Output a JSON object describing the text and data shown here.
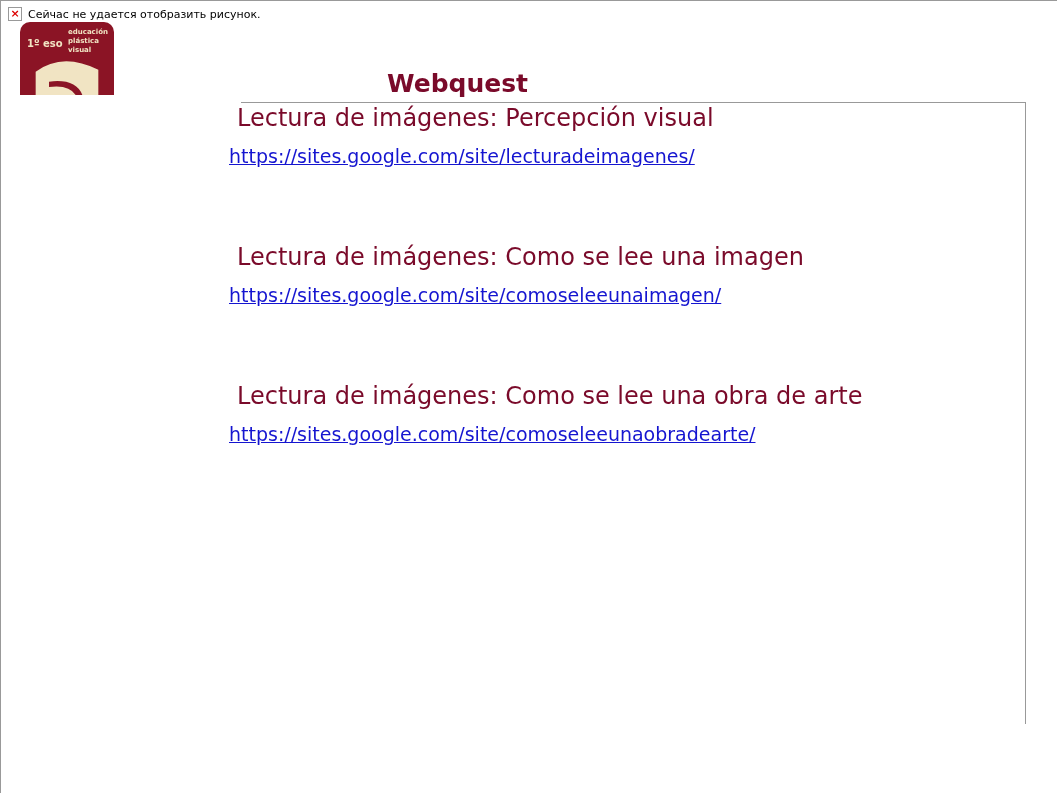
{
  "broken_image": {
    "icon": "×",
    "text": "Сейчас не удается отобразить рисунок."
  },
  "logo": {
    "course": "1º eso",
    "subject": [
      "educación",
      "plástica",
      "visual"
    ]
  },
  "title": "Webquest",
  "sections": [
    {
      "heading": "Lectura de imágenes: Percepción visual",
      "link": "https://sites.google.com/site/lecturadeimagenes/"
    },
    {
      "heading": "Lectura de imágenes: Como se lee una imagen",
      "link": "https://sites.google.com/site/comoseleeunaimagen/"
    },
    {
      "heading": "Lectura de imágenes: Como se lee una obra de arte",
      "link": "https://sites.google.com/site/comoseleeunaobradearte/"
    }
  ]
}
